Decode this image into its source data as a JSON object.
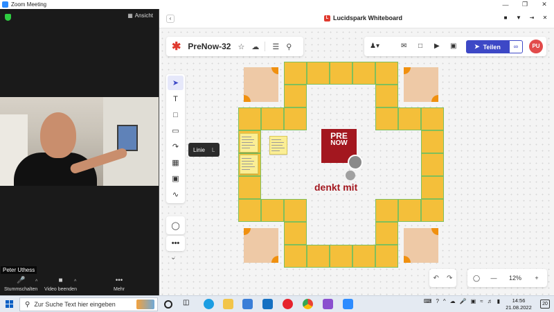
{
  "window": {
    "title": "Zoom Meeting"
  },
  "zoom": {
    "view_label": "Ansicht",
    "participant_name": "Peter Uthess",
    "controls": {
      "mute": "Stummschalten",
      "video": "Video beenden",
      "more": "Mehr"
    }
  },
  "lucid": {
    "app_title": "Lucidspark Whiteboard",
    "doc_title": "PreNow-32",
    "share_label": "Teilen",
    "avatar_initials": "PU",
    "tooltip": {
      "label": "Linie",
      "shortcut": "L"
    },
    "logo": {
      "line1": "PRE",
      "line2": "NOW"
    },
    "slogan": "denkt mit",
    "zoom_level": "12%"
  },
  "taskbar": {
    "search_placeholder": "Zur Suche Text hier eingeben",
    "time": "14:56",
    "date": "21.08.2022",
    "notifications": "20"
  },
  "colors": {
    "accent": "#3d48c6",
    "brand_red": "#a3171f",
    "tile": "#f4bf3a",
    "corner": "#eec9a6"
  }
}
